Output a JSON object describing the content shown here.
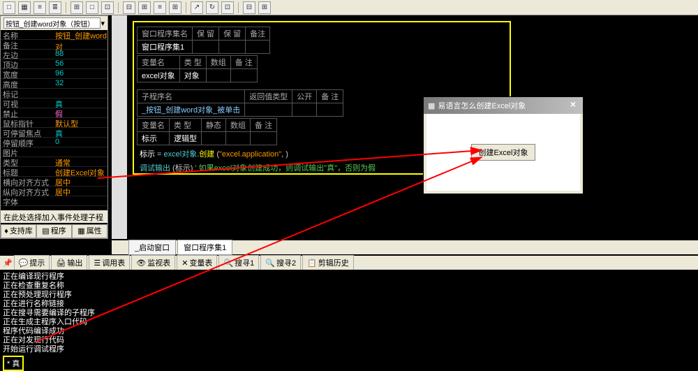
{
  "toolbar_icons": [
    "□",
    "▦",
    "≡",
    "≣",
    "⊞",
    "□",
    "⊡",
    "⊟",
    "⊞",
    "≡",
    "⊞",
    "↗",
    "↻",
    "⊡",
    "⊟",
    "⊞",
    "≡"
  ],
  "left": {
    "dropdown": "按钮_创建word对象（按钮）",
    "props": [
      {
        "k": "名称",
        "v": "按钮_创建word对",
        "c": "v-orange"
      },
      {
        "k": "备注",
        "v": "",
        "c": ""
      },
      {
        "k": "左边",
        "v": "88",
        "c": "v-cyan"
      },
      {
        "k": "顶边",
        "v": "56",
        "c": "v-cyan"
      },
      {
        "k": "宽度",
        "v": "96",
        "c": "v-cyan"
      },
      {
        "k": "高度",
        "v": "32",
        "c": "v-cyan"
      },
      {
        "k": "标记",
        "v": "",
        "c": ""
      },
      {
        "k": "可视",
        "v": "真",
        "c": "v-cyan"
      },
      {
        "k": "禁止",
        "v": "假",
        "c": "v-pink"
      },
      {
        "k": "鼠标指针",
        "v": "默认型",
        "c": "v-orange"
      },
      {
        "k": "可停留焦点",
        "v": "真",
        "c": "v-cyan"
      },
      {
        "k": "停留顺序",
        "v": "0",
        "c": "v-cyan"
      },
      {
        "k": "图片",
        "v": "",
        "c": ""
      },
      {
        "k": "类型",
        "v": "通常",
        "c": "v-orange"
      },
      {
        "k": "标题",
        "v": "创建Excel对象",
        "c": "v-orange"
      },
      {
        "k": "横向对齐方式",
        "v": "居中",
        "c": "v-orange"
      },
      {
        "k": "纵向对齐方式",
        "v": "居中",
        "c": "v-orange"
      },
      {
        "k": "字体",
        "v": "",
        "c": ""
      }
    ],
    "footer": "在此处选择加入事件处理子程序",
    "buttons": [
      "支持库",
      "程序",
      "属性"
    ]
  },
  "code": {
    "head1": [
      "窗口程序集名",
      "保 留",
      "保 留",
      "备注"
    ],
    "head1v": "窗口程序集1",
    "varh": [
      "变量名",
      "类 型",
      "数组",
      "备 注"
    ],
    "varv": [
      "excel对象",
      "对象"
    ],
    "subh": [
      "子程序名",
      "返回值类型",
      "公开",
      "备 注"
    ],
    "subv": "_按钮_创建word对象_被单击",
    "lvh": [
      "变量名",
      "类 型",
      "静态",
      "数组",
      "备 注"
    ],
    "lvv": [
      "标示",
      "逻辑型"
    ],
    "line1_a": "标示",
    "line1_b": " = ",
    "line1_c": "excel对象",
    "line1_d": ".",
    "line1_e": "创建",
    "line1_f": " (",
    "line1_g": "\"excel.application\"",
    "line1_h": ", )",
    "line2_a": "调试输出",
    "line2_b": " (标示)  ",
    "line2_c": "' 如果excel对象创建成功，则调试输出\"真\"，否则为假"
  },
  "tabs": [
    "_启动窗口",
    "窗口程序集1"
  ],
  "out_tabs": [
    "提示",
    "输出",
    "调用表",
    "监视表",
    "变量表",
    "搜寻1",
    "搜寻2",
    "剪辑历史"
  ],
  "output_lines": [
    "正在编译现行程序",
    "正在检查重复名称",
    "正在预处理现行程序",
    "正在进行名称链接",
    "正在搜寻需要编译的子程序",
    "正在生成主程序入口代码",
    "程序代码编译成功",
    "正在对发现行代码",
    "开始运行调试程序"
  ],
  "out_result": "* 真",
  "dialog": {
    "title": "易语言怎么创建Excel对象",
    "button": "创建Excel对象"
  }
}
